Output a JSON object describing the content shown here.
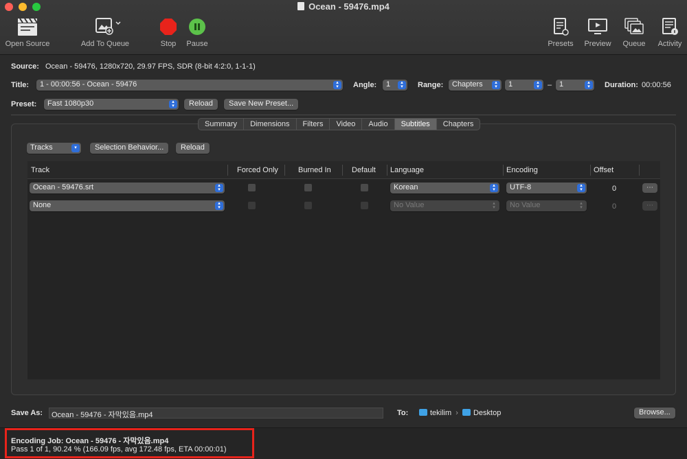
{
  "window": {
    "title": "Ocean - 59476.mp4"
  },
  "toolbar": {
    "open_source": "Open Source",
    "add_to_queue": "Add To Queue",
    "stop": "Stop",
    "pause": "Pause",
    "presets": "Presets",
    "preview": "Preview",
    "queue": "Queue",
    "activity": "Activity"
  },
  "source": {
    "label": "Source:",
    "value": "Ocean - 59476, 1280x720, 29.97 FPS, SDR (8-bit 4:2:0, 1-1-1)"
  },
  "title_row": {
    "label": "Title:",
    "value": "1 - 00:00:56 - Ocean - 59476",
    "angle_label": "Angle:",
    "angle_value": "1",
    "range_label": "Range:",
    "range_mode": "Chapters",
    "range_start": "1",
    "range_dash": "–",
    "range_end": "1",
    "duration_label": "Duration:",
    "duration_value": "00:00:56"
  },
  "preset": {
    "label": "Preset:",
    "value": "Fast 1080p30",
    "reload": "Reload",
    "save_new": "Save New Preset..."
  },
  "tabs": [
    "Summary",
    "Dimensions",
    "Filters",
    "Video",
    "Audio",
    "Subtitles",
    "Chapters"
  ],
  "active_tab": "Subtitles",
  "subtitles": {
    "tracks_popup": "Tracks",
    "selection_behavior": "Selection Behavior...",
    "reload": "Reload",
    "columns": {
      "track": "Track",
      "forced_only": "Forced Only",
      "burned_in": "Burned In",
      "default": "Default",
      "language": "Language",
      "encoding": "Encoding",
      "offset": "Offset"
    },
    "rows": [
      {
        "track": "Ocean - 59476.srt",
        "language": "Korean",
        "encoding": "UTF-8",
        "offset": "0",
        "more": "⋯"
      },
      {
        "track": "None",
        "language": "No Value",
        "encoding": "No Value",
        "offset": "0",
        "more": "⋯"
      }
    ]
  },
  "save": {
    "label": "Save As:",
    "filename": "Ocean - 59476 - 자막있음.mp4",
    "to_label": "To:",
    "path_user": "tekilim",
    "path_sep": "›",
    "path_folder": "Desktop",
    "browse": "Browse..."
  },
  "status": {
    "job": "Encoding Job: Ocean - 59476 - 자막있음.mp4",
    "progress_text": "Pass 1 of 1, 90.24 % (166.09 fps, avg 172.48 fps, ETA 00:00:01)",
    "progress_percent": 90.24
  },
  "colors": {
    "stop": "#e8231b",
    "pause": "#5cc24a",
    "accent": "#2f6ed9",
    "highlight": "#e8231b"
  }
}
